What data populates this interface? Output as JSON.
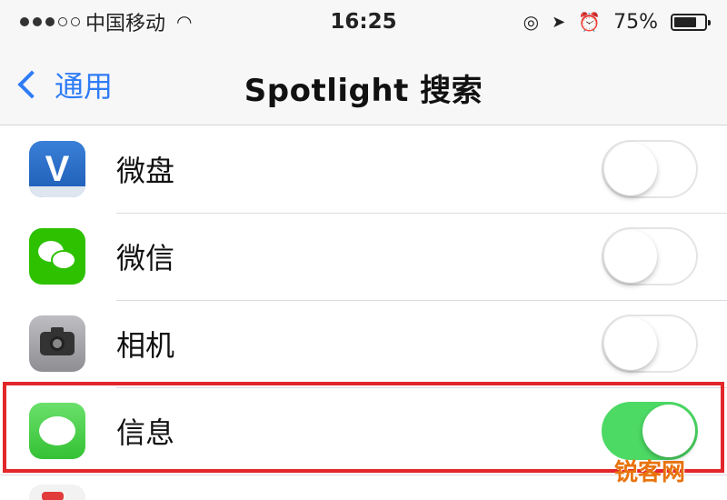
{
  "status_bar": {
    "carrier": "中国移动",
    "time": "16:25",
    "battery_percent_text": "75%",
    "battery_level": 0.75
  },
  "nav": {
    "back_label": "通用",
    "title": "Spotlight 搜索"
  },
  "apps": [
    {
      "name": "微盘",
      "icon": "weipan-icon",
      "enabled": false
    },
    {
      "name": "微信",
      "icon": "wechat-icon",
      "enabled": false
    },
    {
      "name": "相机",
      "icon": "camera-icon",
      "enabled": false
    },
    {
      "name": "信息",
      "icon": "messages-icon",
      "enabled": true
    }
  ],
  "highlighted_row": "信息",
  "colors": {
    "accent": "#2f7cf6",
    "toggle_on": "#4cd964",
    "highlight_border": "#e3262a"
  },
  "watermark": "锐客网"
}
